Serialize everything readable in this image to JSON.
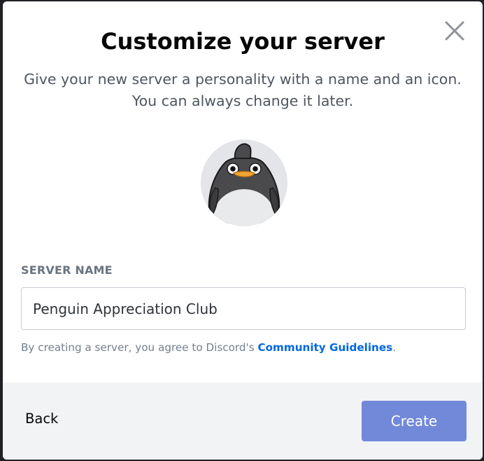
{
  "dialog": {
    "title": "Customize your server",
    "subtitle_line1": "Give your new server a personality with a name and an icon.",
    "subtitle_line2": "You can always change it later.",
    "close_icon": "close-icon",
    "avatar_icon": "penguin-avatar-icon"
  },
  "server_name": {
    "label": "SERVER NAME",
    "value": "Penguin Appreciation Club"
  },
  "terms": {
    "prefix": "By creating a server, you agree to Discord's ",
    "link": "Community Guidelines",
    "suffix": "."
  },
  "footer": {
    "back_label": "Back",
    "create_label": "Create"
  },
  "colors": {
    "accent": "#7289da",
    "link": "#0068e0",
    "footer_bg": "#f2f3f5"
  }
}
